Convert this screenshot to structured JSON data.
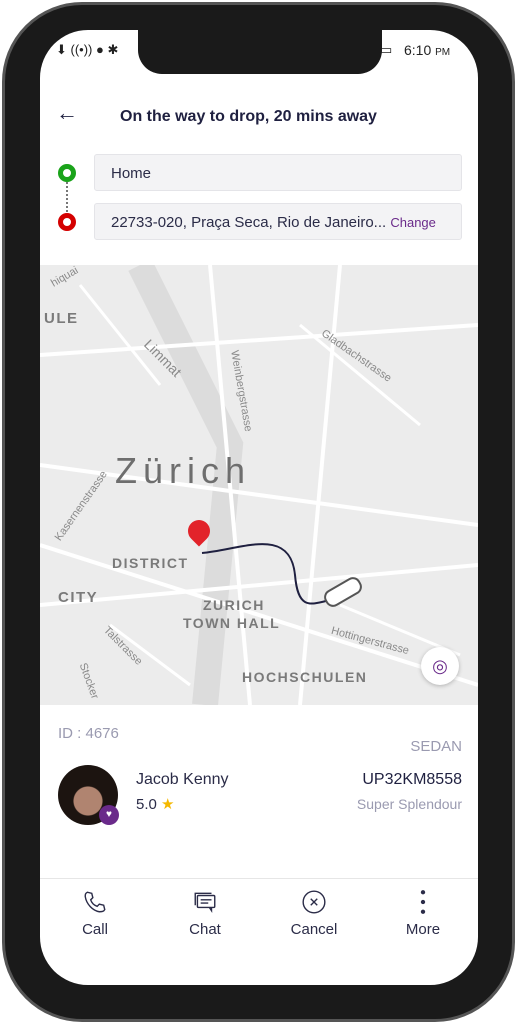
{
  "status_bar": {
    "time": "6:10",
    "ampm": "PM"
  },
  "header": {
    "title": "On the way to drop, 20 mins away"
  },
  "route": {
    "pickup": "Home",
    "drop": "22733-020, Praça Seca, Rio de Janeiro...",
    "change_label": "Change",
    "pickup_color": "#1aa31a",
    "drop_color": "#d40000"
  },
  "map": {
    "labels": [
      "hiquai",
      "ULE",
      "Limmat",
      "Weinbergstrasse",
      "Gladbachstrasse",
      "Zürich",
      "Kasernenstrasse",
      "DISTRICT",
      "CITY",
      "ZURICH",
      "TOWN HALL",
      "Talstrasse",
      "Stocker",
      "Hottingerstrasse",
      "HOCHSCHULEN"
    ]
  },
  "ride": {
    "id": "ID : 4676",
    "driver_name": "Jacob Kenny",
    "rating": "5.0",
    "vehicle_type": "SEDAN",
    "plate": "UP32KM8558",
    "model": "Super Splendour",
    "accent": "#6a2a8a"
  },
  "nav": [
    {
      "label": "Call",
      "icon": "phone-icon"
    },
    {
      "label": "Chat",
      "icon": "chat-icon"
    },
    {
      "label": "Cancel",
      "icon": "cancel-icon"
    },
    {
      "label": "More",
      "icon": "more-vertical-icon"
    }
  ]
}
